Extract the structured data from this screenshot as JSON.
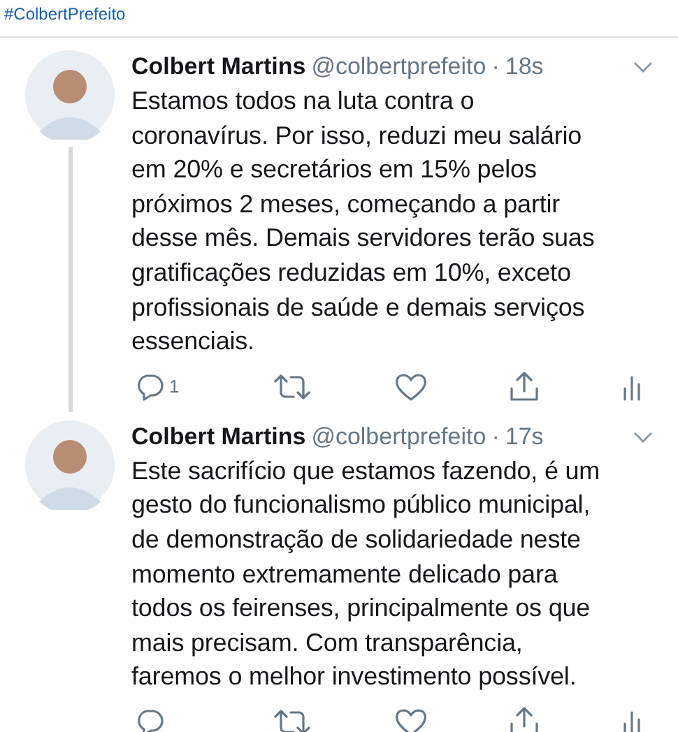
{
  "hashtag": "#ColbertPrefeito",
  "tweets": [
    {
      "name": "Colbert Martins",
      "handle": "@colbertprefeito",
      "separator": "·",
      "time": "18s",
      "lines": [
        "Estamos todos na luta contra o",
        "coronavírus. Por isso, reduzi meu salário",
        "em 20% e secretários em 15% pelos",
        "próximos 2 meses, começando a partir",
        "desse mês. Demais servidores terão suas",
        "gratificações reduzidas em 10%, exceto",
        "profissionais de saúde e demais serviços",
        "essenciais."
      ],
      "reply_count": "1",
      "thread_line": true
    },
    {
      "name": "Colbert Martins",
      "handle": "@colbertprefeito",
      "separator": "·",
      "time": "17s",
      "lines": [
        "Este sacrifício que estamos fazendo, é um",
        "gesto do funcionalismo público municipal,",
        "de demonstração de solidariedade neste",
        "momento extremamente delicado para",
        "todos os feirenses, principalmente os que",
        "mais precisam. Com transparência,",
        "faremos o melhor investimento possível."
      ],
      "thread_line": false
    }
  ]
}
